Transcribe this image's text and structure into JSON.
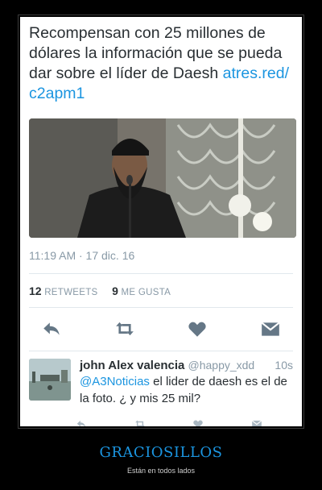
{
  "tweet": {
    "text": "Recompensan con 25 millones de dólares la información que se pueda dar sobre el líder de Daesh ",
    "link": "atres.red/ c2apm1",
    "photo_icon": "bearded-man-photo",
    "timestamp": "11:19 AM · 17 dic. 16",
    "retweets_count": "12",
    "retweets_label": "RETWEETS",
    "likes_count": "9",
    "likes_label": "ME GUSTA"
  },
  "actions": {
    "reply_icon": "reply-icon",
    "retweet_icon": "retweet-icon",
    "like_icon": "heart-icon",
    "message_icon": "direct-message-icon"
  },
  "reply": {
    "name": "john Alex valencia",
    "handle": "@happy_xdd",
    "time": "10s",
    "mention": "@A3Noticias",
    "text": " el lider de daesh es el de la foto. ¿ y mis 25 mil?"
  },
  "footer": {
    "title": "GRACIOSILLOS",
    "subtitle": "Están en todos lados"
  },
  "colors": {
    "accent": "#1b95e0",
    "icon": "#657786",
    "background": "#000000"
  }
}
